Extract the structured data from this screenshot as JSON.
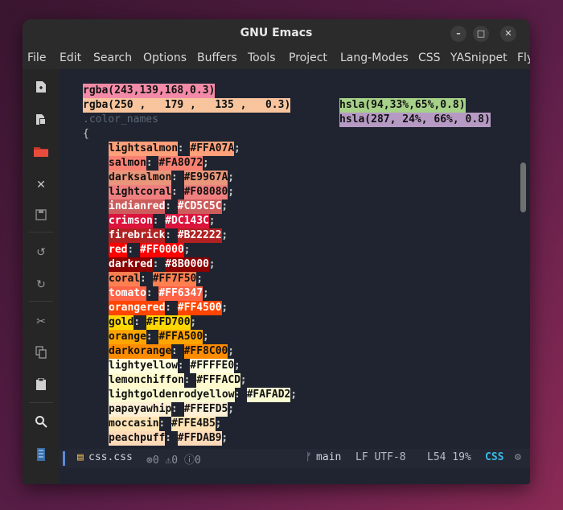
{
  "window": {
    "title": "GNU Emacs",
    "controls": [
      "–",
      "□",
      "✕"
    ]
  },
  "menu": [
    "File",
    "Edit",
    "Search",
    "Options",
    "Buffers",
    "Tools",
    "Project",
    "Lang-Modes",
    "CSS",
    "YASnippet",
    "Fly"
  ],
  "toolbar": [
    "new-file-icon",
    "open-file-icon",
    "directory-icon",
    "close-icon",
    "save-icon",
    "undo-icon",
    "redo-icon",
    "cut-icon",
    "copy-icon",
    "paste-icon",
    "search-icon",
    "preferences-icon"
  ],
  "code": {
    "rgba1": "rgba(243,139,168,0.3)",
    "hsla1": "hsla(94,33%,65%,0.8)",
    "rgba2": "rgba(250 ,   179 ,   135 ,   0.3)",
    "hsla2": "hsla(287, 24%, 66%, 0.8)",
    "selector": ".color_names",
    "open_brace": "{",
    "colors": [
      {
        "name": "lightsalmon",
        "hex": "#FFA07A",
        "bg": "#FFA07A",
        "light": false
      },
      {
        "name": "salmon",
        "hex": "#FA8072",
        "bg": "#FA8072",
        "light": false
      },
      {
        "name": "darksalmon",
        "hex": "#E9967A",
        "bg": "#E9967A",
        "light": false
      },
      {
        "name": "lightcoral",
        "hex": "#F08080",
        "bg": "#F08080",
        "light": false
      },
      {
        "name": "indianred",
        "hex": "#CD5C5C",
        "bg": "#CD5C5C",
        "light": true
      },
      {
        "name": "crimson",
        "hex": "#DC143C",
        "bg": "#DC143C",
        "light": true
      },
      {
        "name": "firebrick",
        "hex": "#B22222",
        "bg": "#B22222",
        "light": true
      },
      {
        "name": "red",
        "hex": "#FF0000",
        "bg": "#FF0000",
        "light": true
      },
      {
        "name": "darkred",
        "hex": "#8B0000",
        "bg": "#8B0000",
        "light": true
      },
      {
        "name": "coral",
        "hex": "#FF7F50",
        "bg": "#FF7F50",
        "light": false
      },
      {
        "name": "tomato",
        "hex": "#FF6347",
        "bg": "#FF6347",
        "light": true
      },
      {
        "name": "orangered",
        "hex": "#FF4500",
        "bg": "#FF4500",
        "light": true
      },
      {
        "name": "gold",
        "hex": "#FFD700",
        "bg": "#FFD700",
        "light": false
      },
      {
        "name": "orange",
        "hex": "#FFA500",
        "bg": "#FFA500",
        "light": false
      },
      {
        "name": "darkorange",
        "hex": "#FF8C00",
        "bg": "#FF8C00",
        "light": false
      },
      {
        "name": "lightyellow",
        "hex": "#FFFFE0",
        "bg": "#FFFFE0",
        "light": false
      },
      {
        "name": "lemonchiffon",
        "hex": "#FFFACD",
        "bg": "#FFFACD",
        "light": false
      },
      {
        "name": "lightgoldenrodyellow",
        "hex": "#FAFAD2",
        "bg": "#FAFAD2",
        "light": false
      },
      {
        "name": "papayawhip",
        "hex": "#FFEFD5",
        "bg": "#FFEFD5",
        "light": false
      },
      {
        "name": "moccasin",
        "hex": "#FFE4B5",
        "bg": "#FFE4B5",
        "light": false
      },
      {
        "name": "peachpuff",
        "hex": "#FFDAB9",
        "bg": "#FFDAB9",
        "light": false
      }
    ]
  },
  "modeline": {
    "filename": "css.css",
    "diagnostics": "⊗0 ⚠0 ⓘ0",
    "branch": "main",
    "encoding": "LF UTF-8",
    "position": "L54 19%",
    "mode": "CSS"
  },
  "accent": {
    "css_mode": "#39bae6",
    "file_icon": "#e6b450"
  }
}
